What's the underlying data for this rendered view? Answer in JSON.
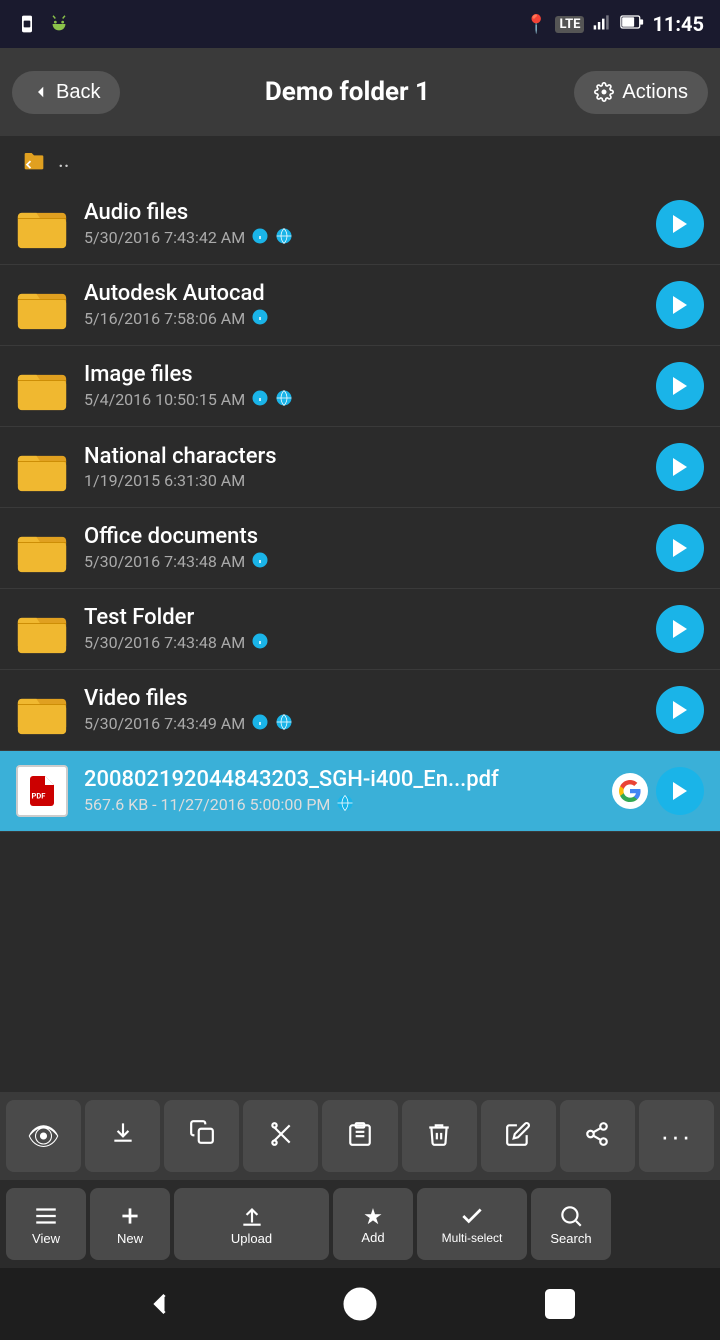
{
  "statusBar": {
    "time": "11:45",
    "icons": [
      "sim-icon",
      "lte-icon",
      "signal-icon",
      "battery-icon"
    ]
  },
  "topBar": {
    "backLabel": "Back",
    "title": "Demo folder 1",
    "actionsLabel": "Actions"
  },
  "parentDir": {
    "label": ".."
  },
  "files": [
    {
      "id": "audio-files",
      "type": "folder",
      "name": "Audio files",
      "meta": "5/30/2016 7:43:42 AM",
      "hasInfo": true,
      "hasGlobe": true,
      "selected": false
    },
    {
      "id": "autodesk-autocad",
      "type": "folder",
      "name": "Autodesk Autocad",
      "meta": "5/16/2016 7:58:06 AM",
      "hasInfo": true,
      "hasGlobe": false,
      "selected": false
    },
    {
      "id": "image-files",
      "type": "folder",
      "name": "Image files",
      "meta": "5/4/2016 10:50:15 AM",
      "hasInfo": true,
      "hasGlobe": true,
      "selected": false
    },
    {
      "id": "national-characters",
      "type": "folder",
      "name": "National characters",
      "meta": "1/19/2015 6:31:30 AM",
      "hasInfo": false,
      "hasGlobe": false,
      "selected": false
    },
    {
      "id": "office-documents",
      "type": "folder",
      "name": "Office documents",
      "meta": "5/30/2016 7:43:48 AM",
      "hasInfo": true,
      "hasGlobe": false,
      "selected": false
    },
    {
      "id": "test-folder",
      "type": "folder",
      "name": "Test Folder",
      "meta": "5/30/2016 7:43:48 AM",
      "hasInfo": true,
      "hasGlobe": false,
      "selected": false
    },
    {
      "id": "video-files",
      "type": "folder",
      "name": "Video files",
      "meta": "5/30/2016 7:43:49 AM",
      "hasInfo": true,
      "hasGlobe": true,
      "selected": false
    },
    {
      "id": "pdf-file",
      "type": "pdf",
      "name": "200802192044843203_SGH-i400_En...pdf",
      "meta": "567.6 KB - 11/27/2016 5:00:00 PM",
      "hasGlobe": true,
      "hasGoogle": true,
      "selected": true
    }
  ],
  "toolbar1": {
    "buttons": [
      {
        "id": "view-btn",
        "label": "View",
        "icon": "👁"
      },
      {
        "id": "download-btn",
        "label": "",
        "icon": "⬇"
      },
      {
        "id": "copy-btn",
        "label": "",
        "icon": "⧉"
      },
      {
        "id": "cut-btn",
        "label": "",
        "icon": "✂"
      },
      {
        "id": "paste-btn",
        "label": "",
        "icon": "📋"
      },
      {
        "id": "delete-btn",
        "label": "",
        "icon": "🗑"
      },
      {
        "id": "edit-btn",
        "label": "",
        "icon": "✏"
      },
      {
        "id": "share-btn",
        "label": "",
        "icon": "⤴"
      },
      {
        "id": "more-btn",
        "label": "",
        "icon": "···"
      }
    ]
  },
  "toolbar2": {
    "buttons": [
      {
        "id": "view-tab-btn",
        "label": "View",
        "icon": "☰"
      },
      {
        "id": "new-btn",
        "label": "New",
        "icon": "+"
      },
      {
        "id": "upload-btn",
        "label": "Upload",
        "icon": "⬆"
      },
      {
        "id": "add-btn",
        "label": "Add",
        "icon": "★"
      },
      {
        "id": "multiselect-btn",
        "label": "Multi-select",
        "icon": "✓"
      },
      {
        "id": "search-btn",
        "label": "Search",
        "icon": "🔍"
      }
    ]
  },
  "bottomNav": {
    "back": "back-nav",
    "home": "home-nav",
    "recents": "recents-nav"
  }
}
